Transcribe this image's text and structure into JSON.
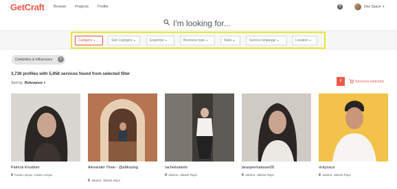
{
  "header": {
    "logo": "GetCraft",
    "nav": [
      "Browse",
      "Projects",
      "Profile"
    ],
    "help_label": "?",
    "user_name": "Dee Space"
  },
  "search": {
    "placeholder": "I'm looking for..."
  },
  "filters": [
    {
      "label": "Category",
      "active": true
    },
    {
      "label": "Sub Category",
      "active": false
    },
    {
      "label": "Expertise",
      "active": false
    },
    {
      "label": "Business type",
      "active": false
    },
    {
      "label": "Stats",
      "active": false
    },
    {
      "label": "Service language",
      "active": false
    },
    {
      "label": "Location",
      "active": false
    }
  ],
  "applied_filter": {
    "label": "Celebrities & Influencers",
    "remove_label": "×"
  },
  "results": {
    "summary": "3,739 profiles with 5,958 services found from selected filter",
    "sort_label": "Sort by:",
    "sort_value": "Relevance"
  },
  "services": {
    "count": "0",
    "label": "Services selected"
  },
  "profiles": [
    {
      "name": "Patricia Knudsen",
      "location": "Kuala Lumpur, Kuala Lumpur"
    },
    {
      "name": "Alexander Thian - @aMrazing",
      "location": "Jakarta, Jakarta Raya"
    },
    {
      "name": "rachelsutanto",
      "location": "Jakarta, Jakarta Raya"
    },
    {
      "name": "laraspermatasari28",
      "location": "Jakarta, Jakarta Raya"
    },
    {
      "name": "rickyzaca",
      "location": "Jakarta, Jakarta Raya"
    }
  ],
  "colors": {
    "accent": "#ee5a4a",
    "highlight": "#e6e635"
  }
}
